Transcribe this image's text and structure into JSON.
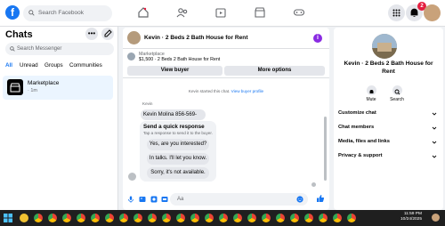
{
  "header": {
    "search_placeholder": "Search Facebook",
    "notification_count": "2",
    "nav_icons": [
      "home-icon",
      "friends-icon",
      "marketplace-icon",
      "store-icon",
      "gaming-icon"
    ]
  },
  "left": {
    "title": "Chats",
    "search_placeholder": "Search Messenger",
    "tabs": [
      "All",
      "Unread",
      "Groups",
      "Communities"
    ],
    "conversation": {
      "name": "Marketplace",
      "time": "· 1m"
    }
  },
  "chat": {
    "title": "Kevin · 2 Beds 2 Bath House for Rent",
    "listing_source": "Marketplace",
    "listing_detail": "$1,500 · 2 Beds 2 Bath House for Rent",
    "view_buyer_label": "View buyer",
    "more_options_label": "More options",
    "started_text": "Kevin started this chat.",
    "started_link": "View buyer profile",
    "sender_name": "Kevin",
    "message": "Kevin Molina 856-569-4234",
    "quick_title": "Send a quick response",
    "quick_subtitle": "Tap a response to send it to the buyer.",
    "quick_responses": [
      "Yes, are you interested?",
      "In talks. I'll let you know.",
      "Sorry, it's not available."
    ],
    "composer_placeholder": "Aa"
  },
  "right": {
    "title_line1": "Kevin · 2 Beds 2 Bath House for",
    "title_line2": "Rent",
    "actions": [
      {
        "label": "Mute"
      },
      {
        "label": "Search"
      }
    ],
    "sections": [
      "Customize chat",
      "Chat members",
      "Media, files and links",
      "Privacy & support"
    ]
  },
  "taskbar": {
    "time": "11:59 PM",
    "date": "10/24/2025"
  },
  "colors": {
    "accent": "#1877f2",
    "badge": "#e41e3f",
    "info": "#8a2be2",
    "taskbar": "#1f1f1f"
  }
}
